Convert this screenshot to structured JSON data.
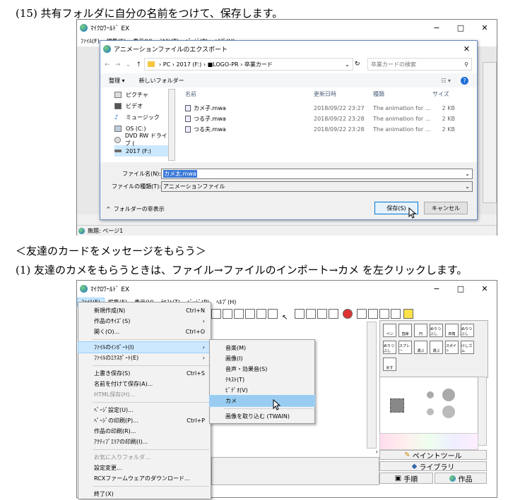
{
  "step15": {
    "text": "(15) 共有フォルダに自分の名前をつけて、保存します。"
  },
  "win1": {
    "title": "ﾏｲｸﾛﾜｰﾙﾄﾞ EX",
    "controls": {
      "min": "−",
      "max": "□",
      "close": "✕"
    },
    "menus": [
      "ﾌｧｲﾙ(F)",
      "編集(E)",
      "表示(V)",
      "ﾃｷｽﾄ(T)",
      "ﾍﾟｰｼﾞ(P)",
      "ﾍﾙﾌﾟ(H)"
    ],
    "status": "無題: ページ1"
  },
  "dialog": {
    "title": "アニメーションファイルのエクスポート",
    "path": [
      "PC",
      "2017 (F:)",
      "■LOGO-PR",
      "卒業カード"
    ],
    "search_placeholder": "卒業カードの検索",
    "organize": "整理 ▾",
    "new_folder": "新しいフォルダー",
    "tree": [
      "ピクチャ",
      "ビデオ",
      "ミュージック",
      "OS (C:)",
      "DVD RW ドライブ (",
      "2017 (F:)"
    ],
    "columns": {
      "name": "名前",
      "date": "更新日時",
      "type": "種類",
      "size": "サイズ"
    },
    "files": [
      {
        "name": "カメ子.mwa",
        "date": "2018/09/22 23:27",
        "type": "The animation for ...",
        "size": "2 KB"
      },
      {
        "name": "つる子.mwa",
        "date": "2018/09/22 23:28",
        "type": "The animation for ...",
        "size": "2 KB"
      },
      {
        "name": "つる夫.mwa",
        "date": "2018/09/22 23:28",
        "type": "The animation for ...",
        "size": "2 KB"
      }
    ],
    "filename_label": "ファイル名(N):",
    "filename_value": "カメ太.mwa",
    "filetype_label": "ファイルの種類(T):",
    "filetype_value": "アニメーションファイル",
    "hide_folders": "フォルダーの非表示",
    "save": "保存(S)",
    "cancel": "キャンセル"
  },
  "section": {
    "heading": "＜友達のカードをメッセージをもらう＞"
  },
  "step1": {
    "text": "(1) 友達のカメをもらうときは、ファイル→ファイルのインポート→カメ を左クリックします。"
  },
  "win2": {
    "title": "ﾏｲｸﾛﾜｰﾙﾄﾞ EX",
    "controls": {
      "min": "−",
      "max": "□",
      "close": "✕"
    },
    "menus": [
      "ﾌｧｲﾙ(F)",
      "編集(E)",
      "表示(V)",
      "ﾃｷｽﾄ(T)",
      "ﾍﾟｰｼﾞ(P)",
      "ﾍﾙﾌﾟ(H)"
    ],
    "file_menu": [
      {
        "label": "新規作成(N)",
        "shortcut": "Ctrl+N"
      },
      {
        "label": "作品のｻｲｽﾞ(S)",
        "shortcut": "›"
      },
      {
        "label": "開く(O)...",
        "shortcut": "Ctrl+O"
      },
      {
        "label": "ﾌｧｲﾙのｲﾝﾎﾟｰﾄ(I)",
        "shortcut": "›"
      },
      {
        "label": "ﾌｧｲﾙのｴｸｽﾎﾟｰﾄ(E)",
        "shortcut": "›"
      },
      {
        "label": "上書き保存(S)",
        "shortcut": "Ctrl+S"
      },
      {
        "label": "名前を付けて保存(A)...",
        "shortcut": ""
      },
      {
        "label": "HTML保存(H)...",
        "shortcut": ""
      },
      {
        "label": "ﾍﾟｰｼﾞ設定(U)...",
        "shortcut": ""
      },
      {
        "label": "ﾍﾟｰｼﾞの印刷(P)...",
        "shortcut": "Ctrl+P"
      },
      {
        "label": "作品の印刷(R)...",
        "shortcut": ""
      },
      {
        "label": "ｱｸﾃｨﾌﾞｴﾘｱの印刷(I)...",
        "shortcut": ""
      },
      {
        "label": "お気に入りフォルダ...",
        "shortcut": ""
      },
      {
        "label": "設定変更...",
        "shortcut": ""
      },
      {
        "label": "RCXファームウェアのダウンロード...",
        "shortcut": ""
      },
      {
        "label": "終了(X)",
        "shortcut": ""
      }
    ],
    "import_menu": [
      "音楽(M)",
      "画像(I)",
      "音声・効果音(S)",
      "ﾃｷｽﾄ(T)",
      "ﾋﾞﾃﾞｵ(V)",
      "カメ",
      "画像を取り込む (TWAIN)"
    ],
    "tools": [
      "ペン",
      "直線",
      "円",
      "ぬりつぶし",
      "四角",
      "ぬりつぶし",
      "ぬりつぶし",
      "スプレー",
      "選ぶ",
      "選ぶ",
      "スポイト",
      "けしゴム",
      "戻す"
    ],
    "tabs": {
      "paint": "ペイントツール",
      "library": "ライブラリ",
      "steps": "手順",
      "works": "作品"
    }
  }
}
